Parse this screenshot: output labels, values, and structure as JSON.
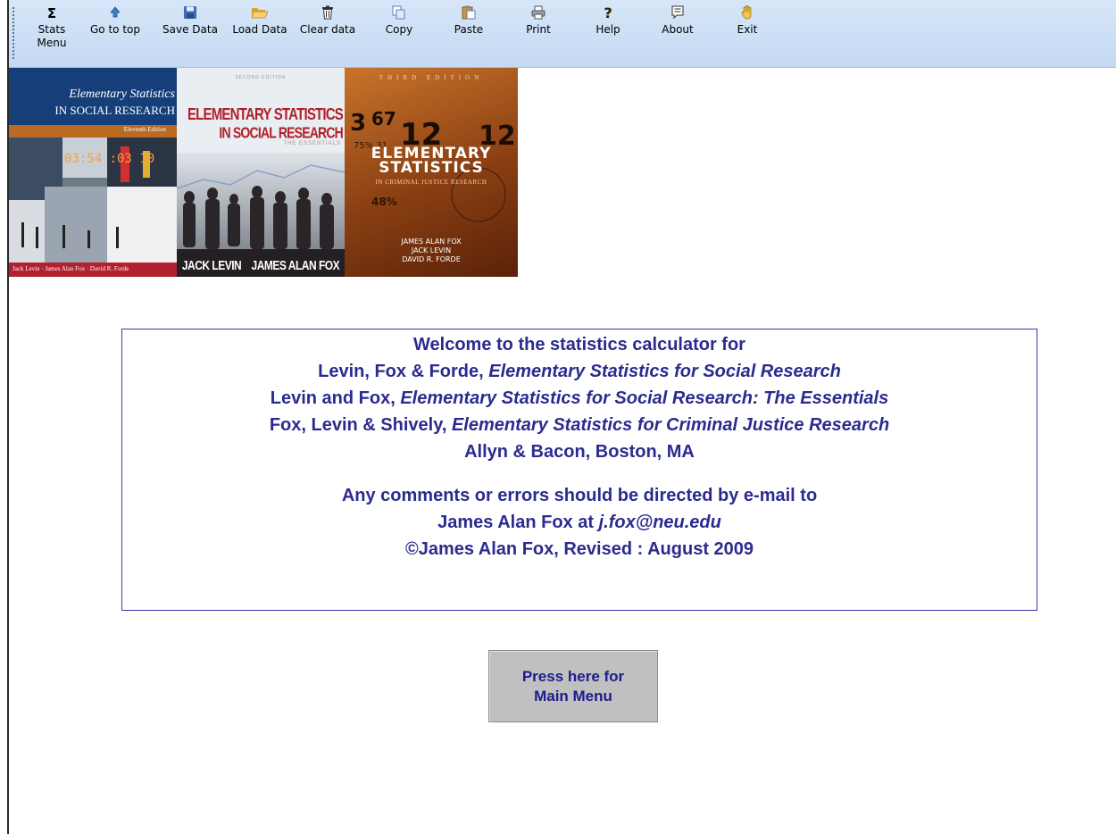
{
  "toolbar": {
    "items": [
      {
        "id": "stats-menu",
        "label": "Stats\nMenu",
        "icon": "sigma-icon"
      },
      {
        "id": "go-to-top",
        "label": "Go to top",
        "icon": "up-arrow-icon"
      },
      {
        "id": "save-data",
        "label": "Save Data",
        "icon": "floppy-icon"
      },
      {
        "id": "load-data",
        "label": "Load Data",
        "icon": "folder-open-icon"
      },
      {
        "id": "clear-data",
        "label": "Clear data",
        "icon": "trash-icon"
      },
      {
        "id": "copy",
        "label": "Copy",
        "icon": "copy-icon"
      },
      {
        "id": "paste",
        "label": "Paste",
        "icon": "paste-icon"
      },
      {
        "id": "print",
        "label": "Print",
        "icon": "printer-icon"
      },
      {
        "id": "help",
        "label": "Help",
        "icon": "question-icon"
      },
      {
        "id": "about",
        "label": "About",
        "icon": "info-note-icon"
      },
      {
        "id": "exit",
        "label": "Exit",
        "icon": "hand-icon"
      }
    ]
  },
  "covers": {
    "cover1": {
      "title_line1": "Elementary Statistics",
      "title_line2": "IN SOCIAL RESEARCH",
      "edition": "Eleventh Edition",
      "authors": "Jack Levin · James Alan Fox · David R. Forde"
    },
    "cover2": {
      "edition": "SECOND EDITION",
      "title_line1": "ELEMENTARY STATISTICS",
      "title_line2": "IN SOCIAL RESEARCH",
      "subtitle": "THE ESSENTIALS",
      "authors": "JACK LEVIN    JAMES ALAN FOX"
    },
    "cover3": {
      "edition": "THIRD EDITION",
      "title_line1": "ELEMENTARY",
      "title_line2": "STATISTICS",
      "subtitle": "IN CRIMINAL JUSTICE RESEARCH",
      "author1": "JAMES ALAN FOX",
      "author2": "JACK LEVIN",
      "author3": "DAVID R. FORDE"
    }
  },
  "welcome": {
    "line1": "Welcome to the statistics calculator for",
    "line2_authors": "Levin, Fox & Forde, ",
    "line2_title": "Elementary Statistics for Social Research",
    "line3_authors": "Levin and Fox, ",
    "line3_title": "Elementary Statistics for Social Research: The Essentials",
    "line4_authors": "Fox, Levin & Shively, ",
    "line4_title": "Elementary Statistics for Criminal Justice Research",
    "line5": "Allyn & Bacon, Boston, MA",
    "line6": "Any comments or errors should be directed by e-mail to",
    "line7_prefix": "James Alan Fox at ",
    "line7_email": "j.fox@neu.edu",
    "line8": "©James Alan Fox, Revised : August 2009"
  },
  "main_button": {
    "line1": "Press here for",
    "line2": "Main Menu"
  }
}
